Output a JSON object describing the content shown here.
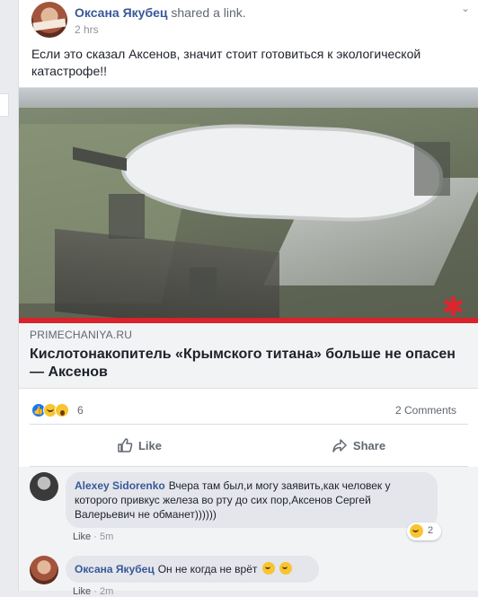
{
  "post": {
    "author": "Оксана Якубец",
    "action": "shared a link.",
    "time": "2 hrs",
    "text": "Если это сказал Аксенов, значит стоит готовиться к экологической катастрофе!!"
  },
  "link": {
    "domain": "PRIMECHANIYA.RU",
    "title": "Кислотонакопитель «Крымского титана» больше не опасен — Аксенов"
  },
  "stats": {
    "reaction_count": "6",
    "comments": "2 Comments",
    "reaction_icons": [
      "like-reaction-icon",
      "haha-reaction-icon",
      "wow-reaction-icon"
    ]
  },
  "actions": {
    "like": "Like",
    "share": "Share"
  },
  "comments": [
    {
      "author": "Alexey Sidorenko",
      "text": "Вчера там был,и могу заявить,как человек у которого привкус железа во рту до сих пор,Аксенов Сергей Валерьевич не обманет))))))",
      "like": "Like",
      "separator": "·",
      "time": "5m",
      "reaction_count": "2"
    },
    {
      "author": "Оксана Якубец",
      "text": "Он не когда не врёт",
      "like": "Like",
      "separator": "·",
      "time": "2m"
    }
  ],
  "colors": {
    "link_blue": "#385898",
    "muted_text": "#606770",
    "accent_red": "#d9222a",
    "like_blue": "#1877f2"
  }
}
